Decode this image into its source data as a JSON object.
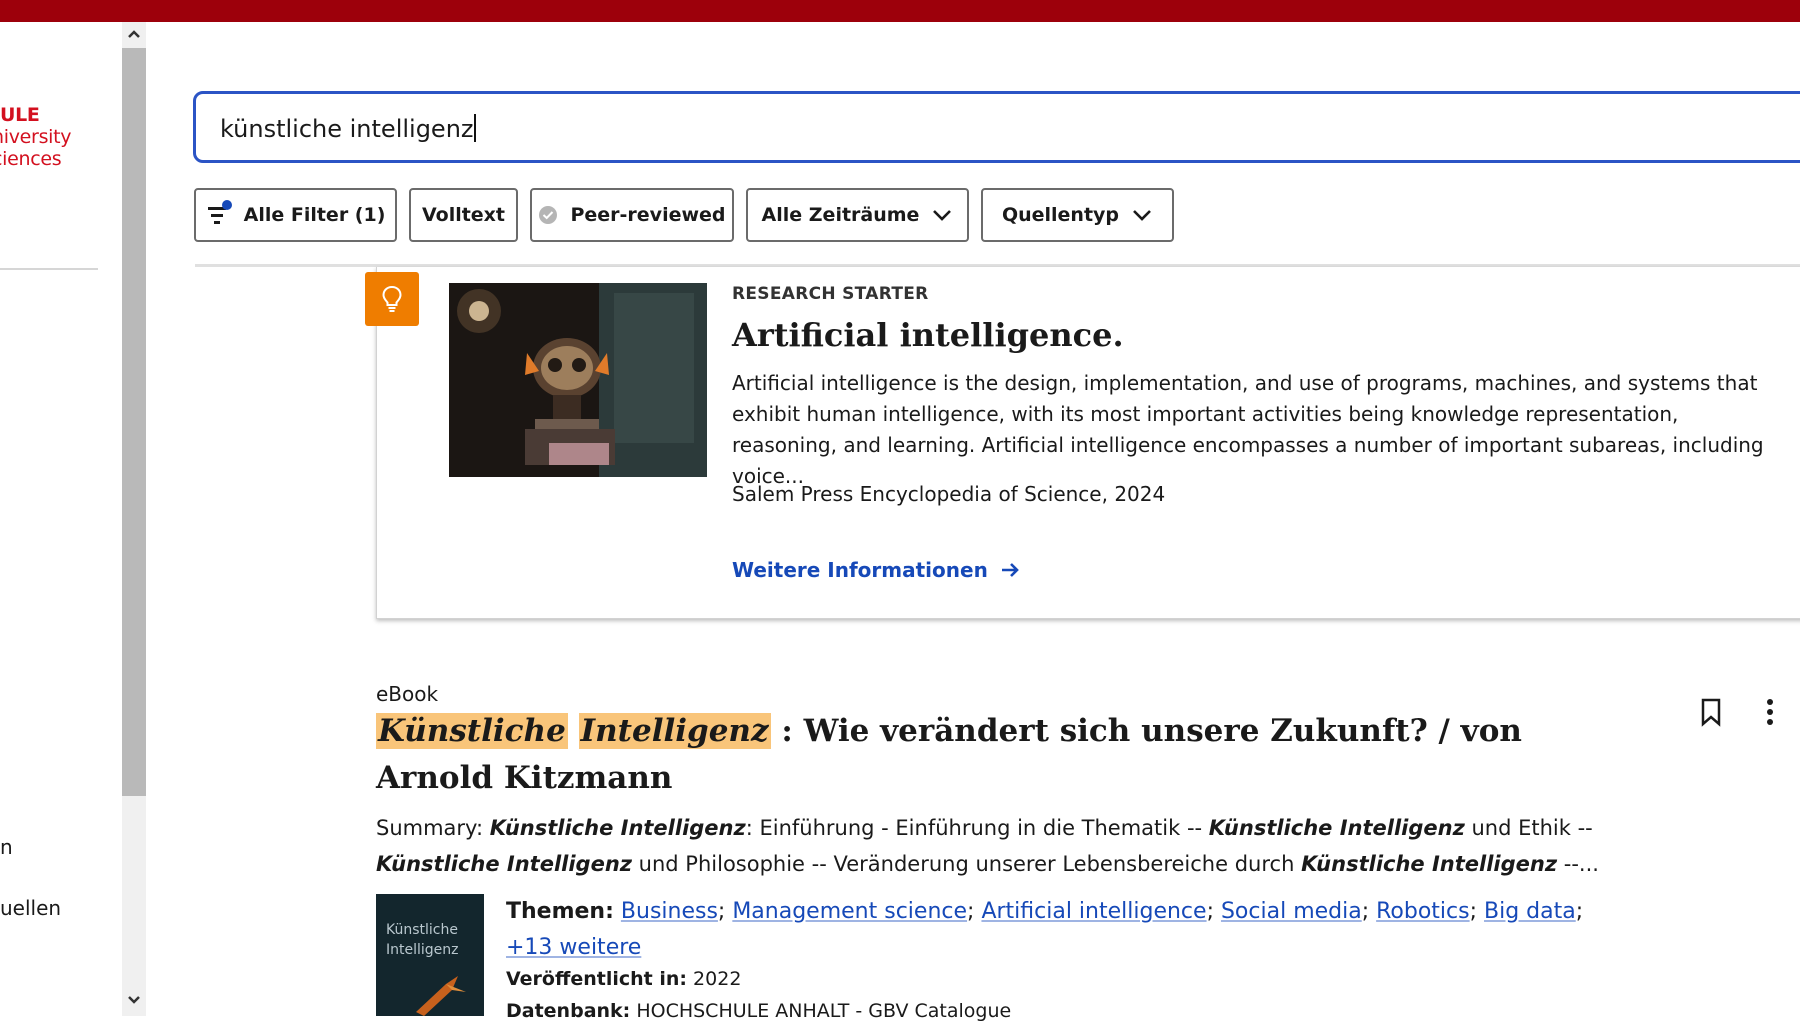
{
  "brand": {
    "logo_line1": "ULE",
    "logo_line2": "niversity",
    "logo_line3": "ciences",
    "accent": "#9d000b"
  },
  "sidebar": {
    "items": [
      {
        "label": "n"
      },
      {
        "label": "uellen"
      }
    ]
  },
  "search": {
    "value": "künstliche intelligenz"
  },
  "filters": {
    "all_filters": "Alle Filter (1)",
    "fulltext": "Volltext",
    "peer_reviewed": "Peer-reviewed",
    "timeframe": "Alle Zeiträume",
    "source_type": "Quellentyp"
  },
  "research_starter": {
    "kicker": "RESEARCH STARTER",
    "title": "Artificial intelligence.",
    "description": "Artificial intelligence is the design, implementation, and use of programs, machines, and systems that exhibit human intelligence, with its most important activities being knowledge representation, reasoning, and learning. Artificial intelligence encompasses a number of important subareas, including voice...",
    "source": "Salem Press Encyclopedia of Science, 2024",
    "more_link": "Weitere Informationen"
  },
  "result": {
    "type": "eBook",
    "title_hl1": "Künstliche",
    "title_hl2": "Intelligenz",
    "title_rest": " : Wie verändert sich unsere Zukunft? / von Arnold Kitzmann",
    "summary_label": "Summary: ",
    "summary_kw1": "Künstliche Intelligenz",
    "summary_t1": ": Einführung - Einführung in die Thematik -- ",
    "summary_kw2": "Künstliche Intelligenz",
    "summary_t2": " und Ethik -- ",
    "summary_kw3": "Künstliche Intelligenz",
    "summary_t3": " und Philosophie -- Veränderung unserer Lebensbereiche durch ",
    "summary_kw4": "Künstliche Intelligenz",
    "summary_t4": " --...",
    "cover_text": "Künstliche Intelligenz",
    "themes_label": "Themen:",
    "themes": [
      "Business",
      "Management science",
      "Artificial intelligence",
      "Social media",
      "Robotics",
      "Big data"
    ],
    "themes_more": "+13 weitere",
    "published_label": "Veröffentlicht in:",
    "published_value": " 2022",
    "database_label": "Datenbank:",
    "database_value": " HOCHSCHULE ANHALT - GBV Catalogue"
  }
}
